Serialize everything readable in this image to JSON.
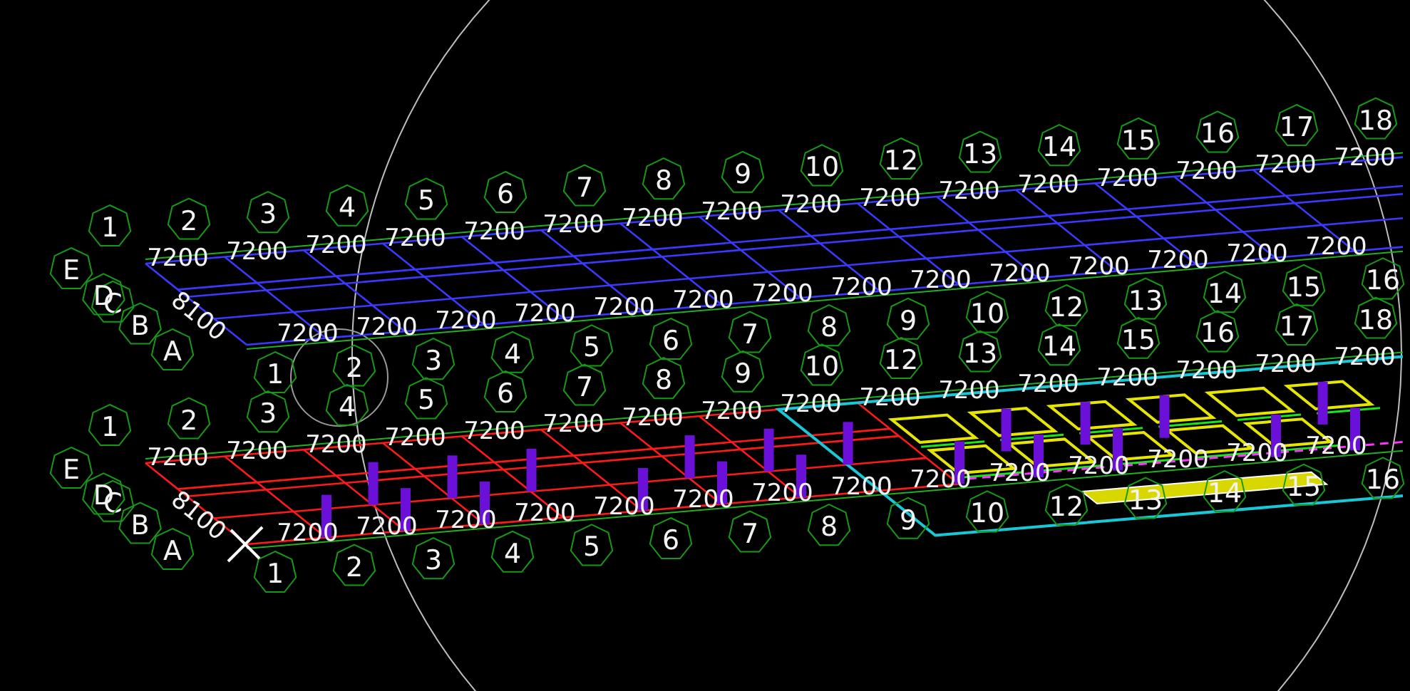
{
  "viewport": {
    "floors": [
      {
        "kind": "upper",
        "row_labels": [
          "A",
          "B",
          "C",
          "D",
          "E"
        ],
        "side_dim": "8100",
        "back_axis": [
          "1",
          "2",
          "3",
          "4",
          "5",
          "6",
          "7",
          "8",
          "9",
          "10",
          "12",
          "13",
          "14",
          "15",
          "16",
          "17",
          "18"
        ],
        "back_dims": [
          "7200",
          "7200",
          "7200",
          "7200",
          "7200",
          "7200",
          "7200",
          "7200",
          "7200",
          "7200",
          "7200",
          "7200",
          "7200",
          "7200",
          "7200",
          "7200"
        ],
        "front_axis": [
          "1",
          "2",
          "3",
          "4",
          "5",
          "6",
          "7",
          "8",
          "9",
          "10",
          "12",
          "13",
          "14",
          "15",
          "16"
        ],
        "front_dims": [
          "7200",
          "7200",
          "7200",
          "7200",
          "7200",
          "7200",
          "7200",
          "7200",
          "7200",
          "7200",
          "7200",
          "7200",
          "7200",
          "7200"
        ]
      },
      {
        "kind": "ground",
        "row_labels": [
          "A",
          "B",
          "C",
          "D",
          "E"
        ],
        "side_dim": "8100",
        "back_axis": [
          "1",
          "2",
          "3",
          "4",
          "5",
          "6",
          "7",
          "8",
          "9",
          "10",
          "12",
          "13",
          "14",
          "15",
          "16",
          "17",
          "18"
        ],
        "back_dims": [
          "7200",
          "7200",
          "7200",
          "7200",
          "7200",
          "7200",
          "7200",
          "7200",
          "7200",
          "7200",
          "7200",
          "7200",
          "7200",
          "7200",
          "7200",
          "7200"
        ],
        "front_axis": [
          "1",
          "2",
          "3",
          "4",
          "5",
          "6",
          "7",
          "8",
          "9",
          "10",
          "12",
          "13",
          "14",
          "15",
          "16"
        ],
        "front_dims": [
          "7200",
          "7200",
          "7200",
          "7200",
          "7200",
          "7200",
          "7200",
          "7200",
          "7200",
          "7200",
          "7200",
          "7200",
          "7200",
          "7200"
        ]
      }
    ]
  }
}
